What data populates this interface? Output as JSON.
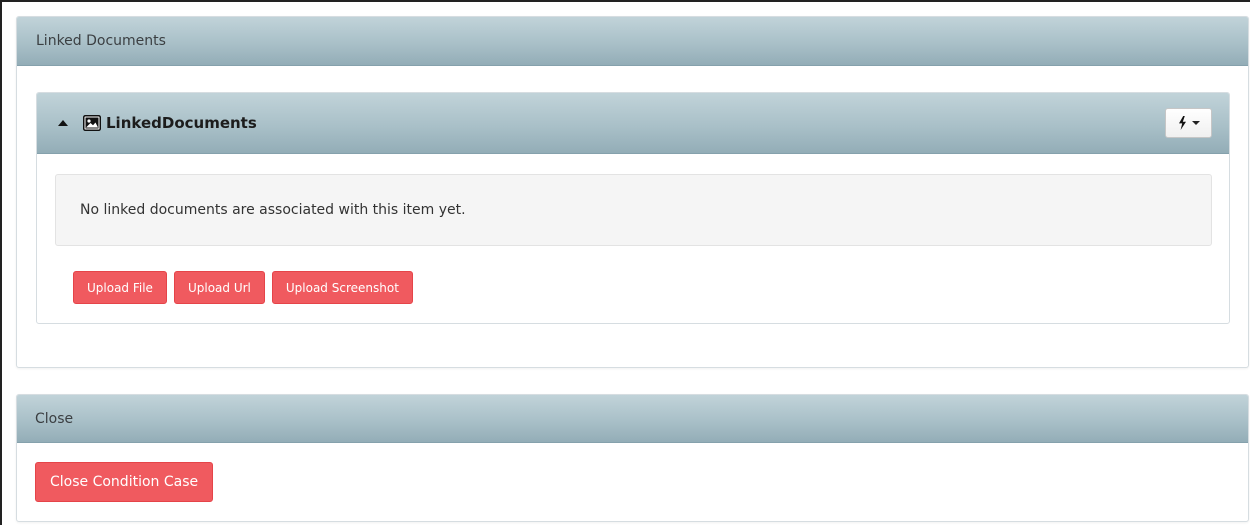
{
  "linked_section": {
    "heading": "Linked Documents",
    "inner_panel": {
      "title": "LinkedDocuments",
      "icons": {
        "collapse": "caret-up-icon",
        "document": "image-icon",
        "actions": "bolt-icon",
        "dropdown": "chevron-down-icon"
      },
      "empty_message": "No linked documents are associated with this item yet.",
      "buttons": {
        "upload_file": "Upload File",
        "upload_url": "Upload Url",
        "upload_screenshot": "Upload Screenshot"
      }
    }
  },
  "close_section": {
    "heading": "Close",
    "button": "Close Condition Case"
  },
  "colors": {
    "header_gradient_top": "#c1d3d9",
    "header_gradient_bottom": "#93adb7",
    "danger_button": "#f05a5f",
    "well_background": "#f5f5f5"
  }
}
